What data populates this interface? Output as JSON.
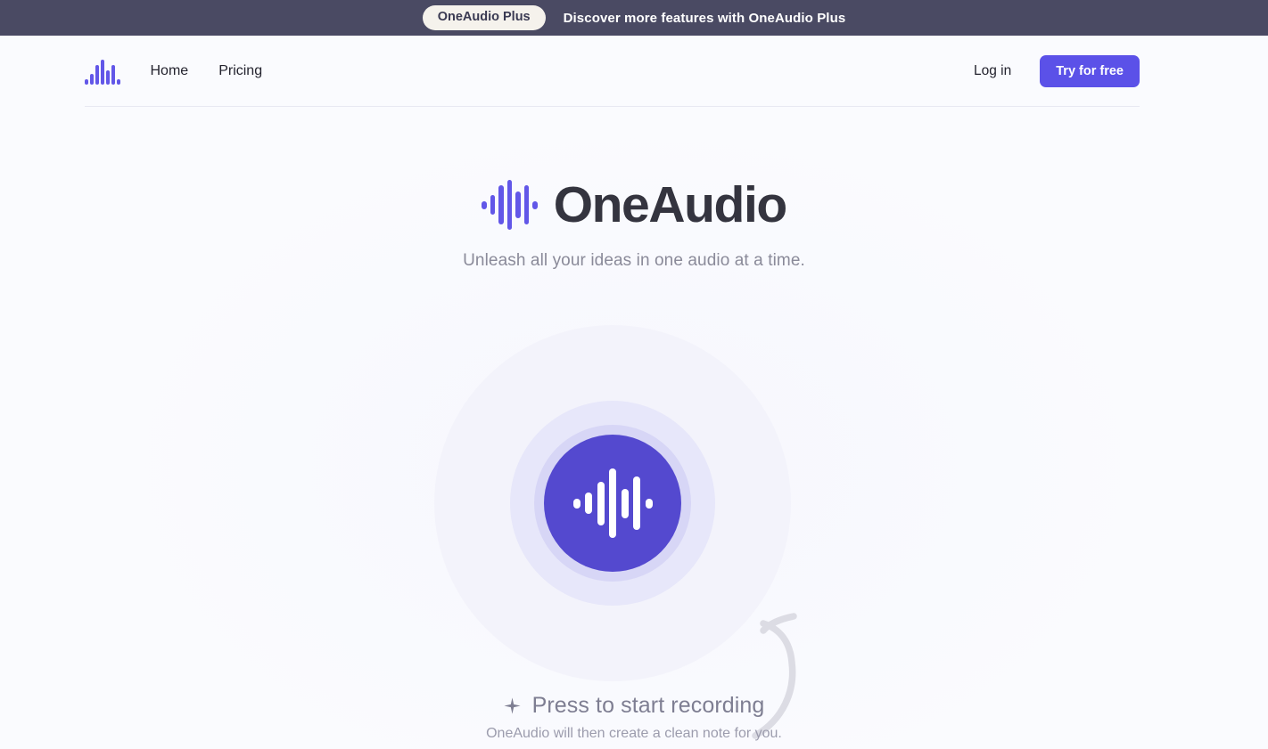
{
  "banner": {
    "pill_label": "OneAudio Plus",
    "message": "Discover more features with OneAudio Plus",
    "background_color": "#4a4a63",
    "pill_background": "#f5f2ec"
  },
  "nav": {
    "logo_name": "oneaudio-waveform-logo",
    "links": [
      {
        "label": "Home"
      },
      {
        "label": "Pricing"
      }
    ],
    "login_label": "Log in",
    "cta_label": "Try for free",
    "cta_color": "#5b51e8"
  },
  "hero": {
    "title": "OneAudio",
    "subtitle": "Unleash all your ideas in one audio at a time.",
    "logo_name": "oneaudio-waveform-logo",
    "accent_color": "#6257e8",
    "title_color": "#34343f"
  },
  "recorder": {
    "button_name": "record-button",
    "icon_name": "waveform-icon",
    "button_color": "#5449cf",
    "ring_mid_color": "#e7e7fa",
    "ring_outer_color": "#f3f3fb"
  },
  "prompt": {
    "sparkle_icon": "sparkle-icon",
    "main_text": "Press to start recording",
    "sub_text": "OneAudio will then create a clean note for you."
  },
  "doodle": {
    "name": "curved-arrow-doodle",
    "color": "#dcdce4"
  }
}
